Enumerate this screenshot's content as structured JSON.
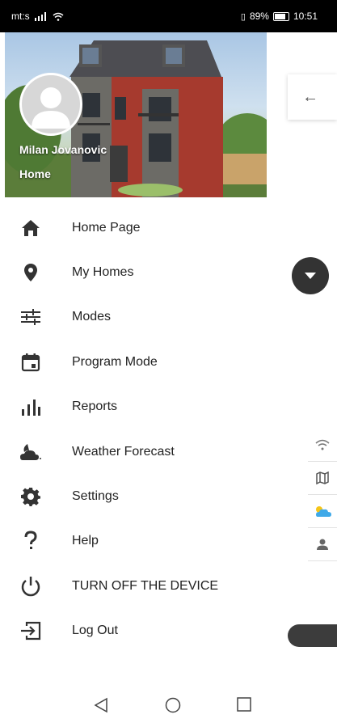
{
  "status_bar": {
    "carrier": "mt:s",
    "battery": "89%",
    "time": "10:51"
  },
  "drawer": {
    "header": {
      "user_name": "Milan Jovanovic",
      "home_name": "Home"
    },
    "items": [
      {
        "label": "Home Page",
        "icon": "home-icon"
      },
      {
        "label": "My Homes",
        "icon": "location-pin-icon"
      },
      {
        "label": "Modes",
        "icon": "sliders-icon"
      },
      {
        "label": "Program Mode",
        "icon": "calendar-icon"
      },
      {
        "label": "Reports",
        "icon": "bar-chart-icon"
      },
      {
        "label": "Weather Forecast",
        "icon": "weather-icon"
      },
      {
        "label": "Settings",
        "icon": "gear-icon"
      },
      {
        "label": "Help",
        "icon": "question-icon"
      },
      {
        "label": "TURN OFF THE DEVICE",
        "icon": "power-icon"
      },
      {
        "label": "Log Out",
        "icon": "logout-icon"
      }
    ]
  },
  "background_app": {
    "right_icons": [
      "wifi-icon",
      "map-icon",
      "weather-icon",
      "person-icon"
    ]
  },
  "colors": {
    "icon": "#333333",
    "text": "#222222",
    "fab": "#333333"
  }
}
